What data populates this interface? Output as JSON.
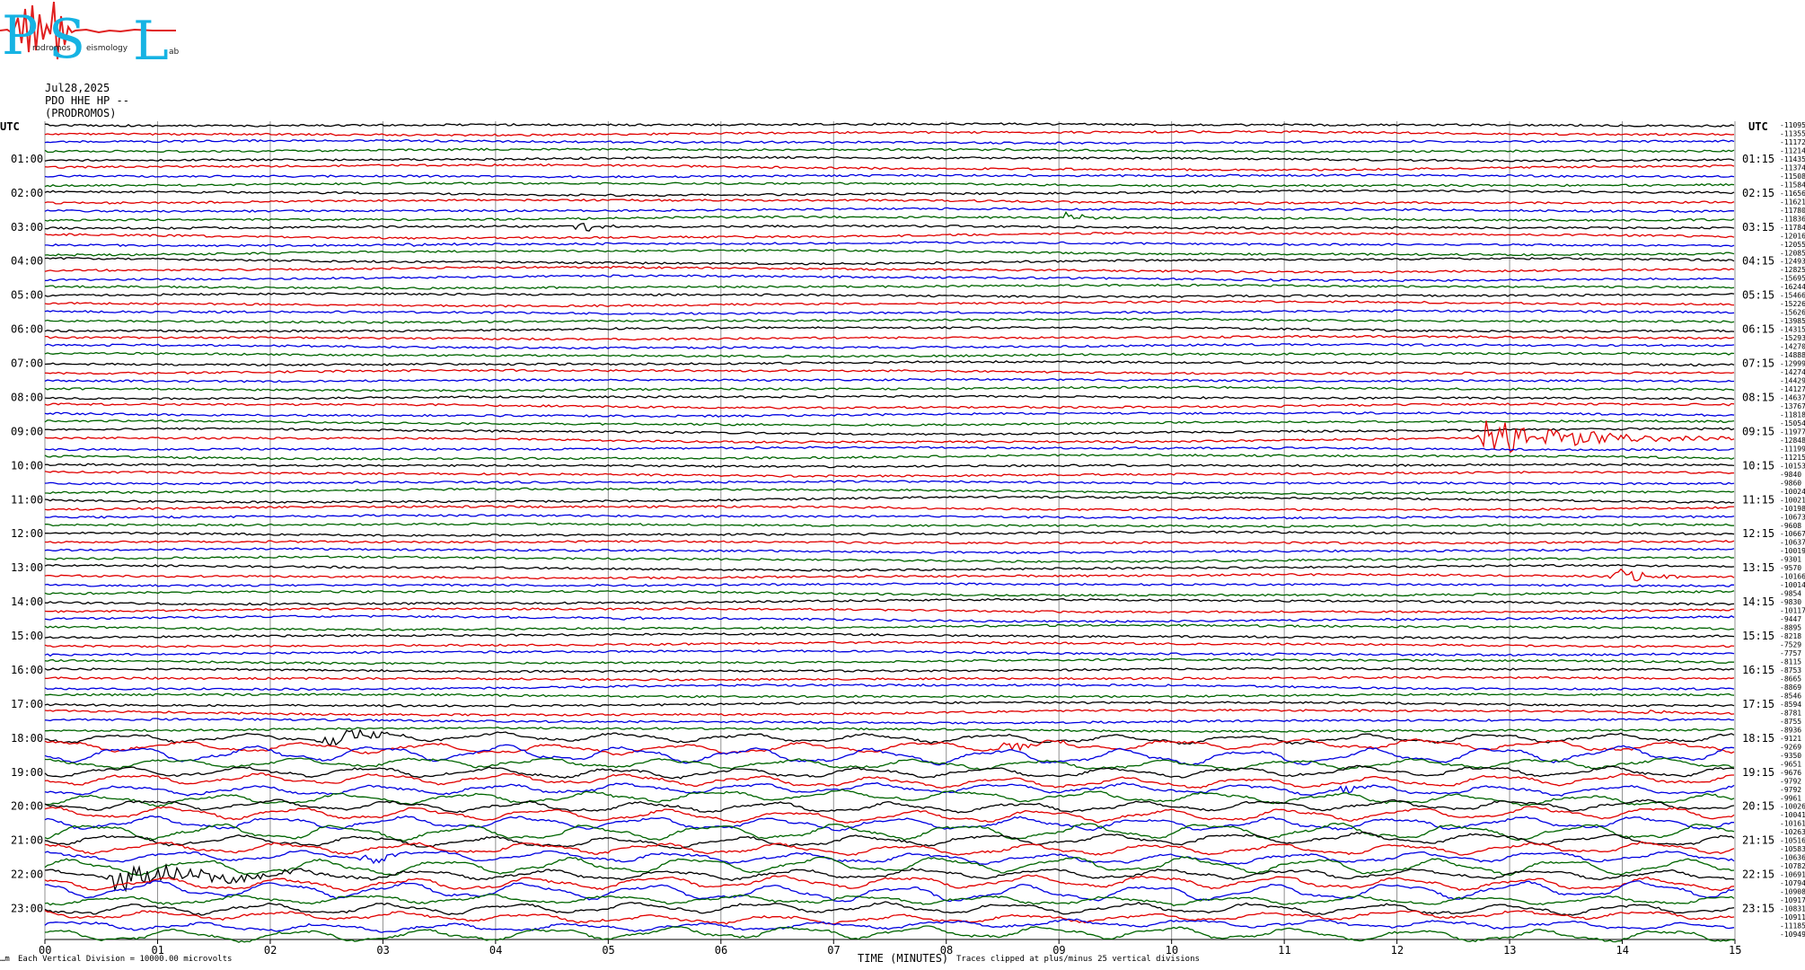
{
  "logo": {
    "letters": [
      "P",
      "S",
      "L"
    ],
    "subtext": [
      "rodromos",
      "eismology",
      "ab"
    ],
    "colors": {
      "letters": "#16b3e3",
      "seismo": "#e02020",
      "subtext": "#222222"
    }
  },
  "header": {
    "date": "Jul28,2025",
    "station": "PDO HHE HP --",
    "location": "(PRODROMOS)"
  },
  "labels": {
    "utc_left": "UTC",
    "utc_right": "UTC",
    "footer_scale": "Each Vertical Division = 10000.00 microvolts",
    "footer_clip": "Traces clipped at plus/minus 25 vertical divisions",
    "footer_mark": "…m"
  },
  "chart_data": {
    "type": "line",
    "xlabel": "TIME (MINUTES)",
    "xlim": [
      0,
      15
    ],
    "x_ticks": [
      "00",
      "01",
      "02",
      "03",
      "04",
      "05",
      "06",
      "07",
      "08",
      "09",
      "10",
      "11",
      "12",
      "13",
      "14",
      "15"
    ],
    "trace_colors": [
      "#000000",
      "#e00000",
      "#0000e0",
      "#006400"
    ],
    "left_hour_labels": [
      "01:00",
      "02:00",
      "03:00",
      "04:00",
      "05:00",
      "06:00",
      "07:00",
      "08:00",
      "09:00",
      "10:00",
      "11:00",
      "12:00",
      "13:00",
      "14:00",
      "15:00",
      "16:00",
      "17:00",
      "18:00",
      "19:00",
      "20:00",
      "21:00",
      "22:00",
      "23:00"
    ],
    "right_hour_labels": [
      "01:15",
      "02:15",
      "03:15",
      "04:15",
      "05:15",
      "06:15",
      "07:15",
      "08:15",
      "09:15",
      "10:15",
      "11:15",
      "12:15",
      "13:15",
      "14:15",
      "15:15",
      "16:15",
      "17:15",
      "18:15",
      "19:15",
      "20:15",
      "21:15",
      "22:15",
      "23:15"
    ],
    "right_offsets": [
      "-11095",
      "-11355",
      "-11172",
      "-11214",
      "-11435",
      "-11374",
      "-11508",
      "-11584",
      "-11656",
      "-11621",
      "-11780",
      "-11836",
      "-11784",
      "-12016",
      "-12055",
      "-12085",
      "-12493",
      "-12825",
      "-15695",
      "-16244",
      "-15466",
      "-15226",
      "-15626",
      "-13985",
      "-14315",
      "-15293",
      "-14270",
      "-14888",
      "-12999",
      "-14274",
      "-14429",
      "-14127",
      "-14637",
      "-13767",
      "-11818",
      "-15054",
      "-11977",
      "-12848",
      "-11199",
      "-11215",
      "-10153",
      "-9840",
      "-9860",
      "-10024",
      "-10021",
      "-10198",
      "-10673",
      "-9608",
      "-10667",
      "-10637",
      "-10019",
      "-9301",
      "-9570",
      "-10166",
      "-10014",
      "-9854",
      "-9830",
      "-10117",
      "-9447",
      "-8895",
      "-8218",
      "-7529",
      "-7757",
      "-8115",
      "-8753",
      "-8665",
      "-8869",
      "-8546",
      "-8594",
      "-8781",
      "-8755",
      "-8936",
      "-9121",
      "-9269",
      "-9350",
      "-9651",
      "-9676",
      "-9792",
      "-9792",
      "-9961",
      "-10026",
      "-10041",
      "-10161",
      "-10263",
      "-10516",
      "-10583",
      "-10636",
      "-10782",
      "-10691",
      "-10794",
      "-10908",
      "-10917",
      "-10831",
      "-10911",
      "-11185",
      "-10949"
    ],
    "events": [
      {
        "row": 11,
        "minute": 9.05,
        "duration": 0.6,
        "amplitude": 6
      },
      {
        "row": 12,
        "minute": 4.75,
        "duration": 0.5,
        "amplitude": 8
      },
      {
        "row": 14,
        "minute": 3.2,
        "duration": 0.5,
        "amplitude": 4
      },
      {
        "row": 37,
        "minute": 12.75,
        "duration": 2.4,
        "amplitude": 22
      },
      {
        "row": 53,
        "minute": 13.9,
        "duration": 0.8,
        "amplitude": 12
      },
      {
        "row": 58,
        "minute": 5.1,
        "duration": 0.3,
        "amplitude": 3
      },
      {
        "row": 69,
        "minute": 14.2,
        "duration": 0.5,
        "amplitude": 3
      },
      {
        "row": 72,
        "minute": 2.5,
        "duration": 1.0,
        "amplitude": 10
      },
      {
        "row": 73,
        "minute": 8.5,
        "duration": 1.1,
        "amplitude": 6
      },
      {
        "row": 78,
        "minute": 11.5,
        "duration": 0.4,
        "amplitude": 6
      },
      {
        "row": 86,
        "minute": 2.8,
        "duration": 0.8,
        "amplitude": 6
      },
      {
        "row": 88,
        "minute": 0.6,
        "duration": 2.8,
        "amplitude": 14
      }
    ]
  }
}
